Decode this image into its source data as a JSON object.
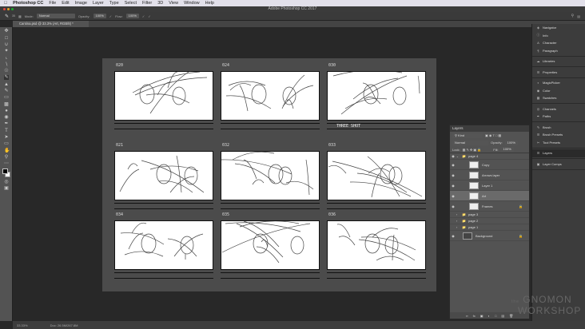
{
  "menubar": {
    "app": "Photoshop CC",
    "items": [
      "File",
      "Edit",
      "Image",
      "Layer",
      "Type",
      "Select",
      "Filter",
      "3D",
      "View",
      "Window",
      "Help"
    ]
  },
  "window_title": "Adobe Photoshop CC 2017",
  "options": {
    "brush_size": "35",
    "mode_label": "Mode:",
    "mode": "Normal",
    "opacity_label": "Opacity:",
    "opacity": "100%",
    "flow_label": "Flow:",
    "flow": "100%"
  },
  "document_tab": "Cantina.psd @ 33.3% (Art, RGB/8) *",
  "storyboard": {
    "panels": [
      {
        "label": "020"
      },
      {
        "label": "024"
      },
      {
        "label": "030",
        "note": "THREE SHOT"
      },
      {
        "label": "021"
      },
      {
        "label": "032"
      },
      {
        "label": "033"
      },
      {
        "label": "034"
      },
      {
        "label": "035"
      },
      {
        "label": "036"
      }
    ]
  },
  "layers_panel": {
    "tab": "Layers",
    "filter": "Kind",
    "blend": "Normal",
    "opacity_label": "Opacity:",
    "opacity": "100%",
    "lock_label": "Lock:",
    "fill_label": "Fill:",
    "fill": "100%",
    "layers": [
      {
        "name": "page 4",
        "type": "group",
        "visible": true
      },
      {
        "name": "Copy",
        "visible": true
      },
      {
        "name": "Arrows layer",
        "visible": true
      },
      {
        "name": "Layer 1",
        "visible": true
      },
      {
        "name": "Art",
        "visible": true,
        "selected": true
      },
      {
        "name": "Frames",
        "visible": true,
        "locked": true
      },
      {
        "name": "page 3",
        "type": "group"
      },
      {
        "name": "page 2",
        "type": "group"
      },
      {
        "name": "page 1",
        "type": "group"
      },
      {
        "name": "Background",
        "visible": true,
        "locked": true
      }
    ]
  },
  "dock": [
    [
      "Navigator",
      "Info",
      "Character",
      "Paragraph"
    ],
    [
      "Libraries"
    ],
    [
      "Properties"
    ],
    [
      "MagicPicker",
      "Color",
      "Swatches"
    ],
    [
      "Channels",
      "Paths"
    ],
    [
      "Brush",
      "Brush Presets",
      "Tool Presets"
    ],
    [
      "Layers"
    ],
    [
      "Layer Comps"
    ]
  ],
  "status": {
    "zoom": "33.33%",
    "doc": "Doc: 26.5M/267.8M"
  },
  "watermark": "the GNOMON WORKSHOP"
}
